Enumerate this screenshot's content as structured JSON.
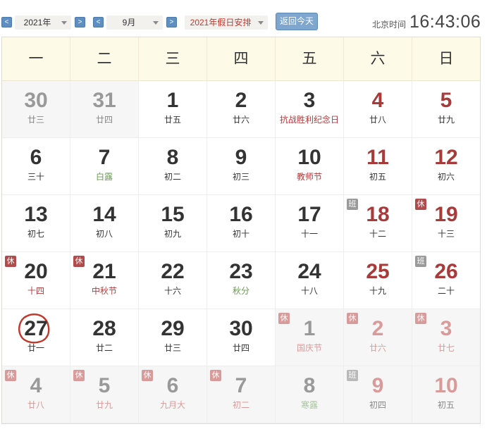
{
  "toolbar": {
    "prev_year": "<",
    "year": "2021年",
    "next_year": ">",
    "prev_month": "<",
    "month": "9月",
    "next_month": ">",
    "holiday_select": "2021年假日安排",
    "today_button": "返回今天",
    "time_label": "北京时间",
    "time": "16:43:06"
  },
  "weekdays": [
    "一",
    "二",
    "三",
    "四",
    "五",
    "六",
    "日"
  ],
  "colors": {
    "accent": "#a93a3a",
    "header_bg": "#fefae8",
    "button": "#7ea6cf"
  },
  "days": [
    {
      "num": "30",
      "sub": "廿三",
      "other": true
    },
    {
      "num": "31",
      "sub": "廿四",
      "other": true
    },
    {
      "num": "1",
      "sub": "廿五"
    },
    {
      "num": "2",
      "sub": "廿六"
    },
    {
      "num": "3",
      "sub": "抗战胜利纪念日",
      "sub_style": "red"
    },
    {
      "num": "4",
      "sub": "廿八",
      "weekend": true
    },
    {
      "num": "5",
      "sub": "廿九",
      "weekend": true
    },
    {
      "num": "6",
      "sub": "三十"
    },
    {
      "num": "7",
      "sub": "白露",
      "sub_style": "green"
    },
    {
      "num": "8",
      "sub": "初二"
    },
    {
      "num": "9",
      "sub": "初三"
    },
    {
      "num": "10",
      "sub": "教师节",
      "sub_style": "red"
    },
    {
      "num": "11",
      "sub": "初五",
      "weekend": true
    },
    {
      "num": "12",
      "sub": "初六",
      "weekend": true
    },
    {
      "num": "13",
      "sub": "初七"
    },
    {
      "num": "14",
      "sub": "初八"
    },
    {
      "num": "15",
      "sub": "初九"
    },
    {
      "num": "16",
      "sub": "初十"
    },
    {
      "num": "17",
      "sub": "十一"
    },
    {
      "num": "18",
      "sub": "十二",
      "weekend": true,
      "badge": "班"
    },
    {
      "num": "19",
      "sub": "十三",
      "weekend": true,
      "badge": "休"
    },
    {
      "num": "20",
      "sub": "十四",
      "sub_style": "red",
      "badge": "休"
    },
    {
      "num": "21",
      "sub": "中秋节",
      "sub_style": "red",
      "badge": "休"
    },
    {
      "num": "22",
      "sub": "十六"
    },
    {
      "num": "23",
      "sub": "秋分",
      "sub_style": "green"
    },
    {
      "num": "24",
      "sub": "十八"
    },
    {
      "num": "25",
      "sub": "十九",
      "weekend": true
    },
    {
      "num": "26",
      "sub": "二十",
      "weekend": true,
      "badge": "班"
    },
    {
      "num": "27",
      "sub": "廿一",
      "today": true
    },
    {
      "num": "28",
      "sub": "廿二"
    },
    {
      "num": "29",
      "sub": "廿三"
    },
    {
      "num": "30",
      "sub": "廿四"
    },
    {
      "num": "1",
      "sub": "国庆节",
      "sub_style": "red",
      "other": true,
      "badge": "休"
    },
    {
      "num": "2",
      "sub": "廿六",
      "sub_style": "red",
      "other": true,
      "weekend": true,
      "badge": "休"
    },
    {
      "num": "3",
      "sub": "廿七",
      "sub_style": "red",
      "other": true,
      "weekend": true,
      "badge": "休"
    },
    {
      "num": "4",
      "sub": "廿八",
      "sub_style": "red",
      "other": true,
      "badge": "休"
    },
    {
      "num": "5",
      "sub": "廿九",
      "sub_style": "red",
      "other": true,
      "badge": "休"
    },
    {
      "num": "6",
      "sub": "九月大",
      "sub_style": "red",
      "other": true,
      "badge": "休"
    },
    {
      "num": "7",
      "sub": "初二",
      "sub_style": "red",
      "other": true,
      "badge": "休"
    },
    {
      "num": "8",
      "sub": "寒露",
      "sub_style": "green",
      "other": true
    },
    {
      "num": "9",
      "sub": "初四",
      "other": true,
      "weekend": true,
      "badge": "班"
    },
    {
      "num": "10",
      "sub": "初五",
      "other": true,
      "weekend": true
    }
  ]
}
